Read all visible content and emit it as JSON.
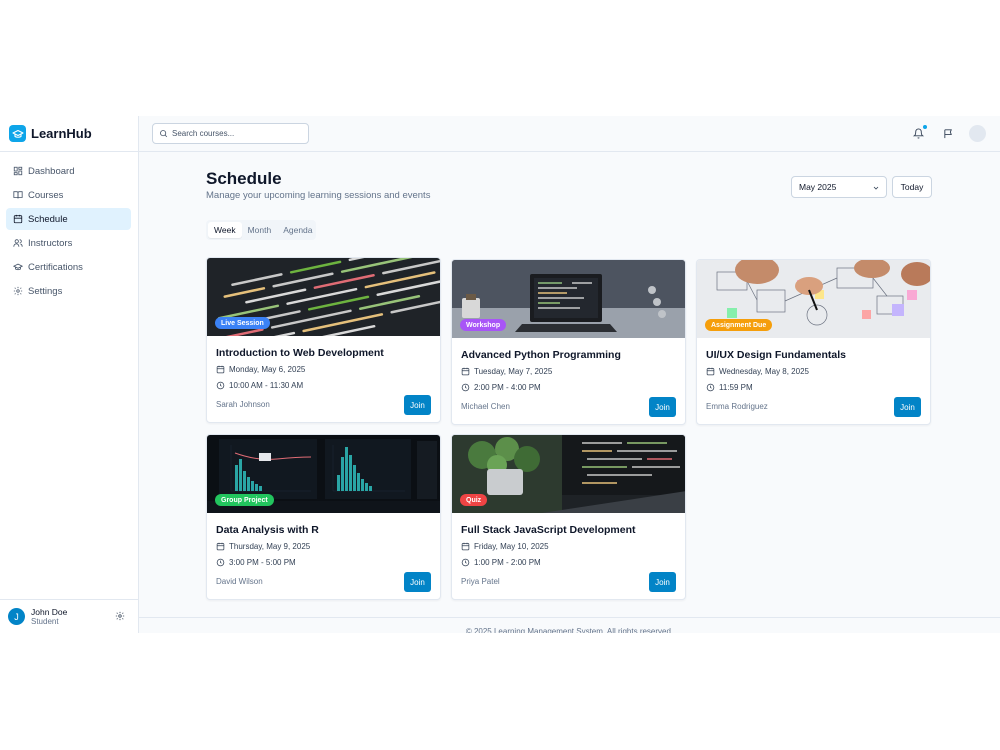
{
  "brand": {
    "name": "LearnHub",
    "color": "#0ea5e9"
  },
  "search": {
    "placeholder": "Search courses..."
  },
  "sidebar": {
    "items": [
      {
        "label": "Dashboard",
        "icon": "grid-icon"
      },
      {
        "label": "Courses",
        "icon": "book-icon"
      },
      {
        "label": "Schedule",
        "icon": "calendar-icon",
        "active": true
      },
      {
        "label": "Instructors",
        "icon": "users-icon"
      },
      {
        "label": "Certifications",
        "icon": "graduation-cap-icon"
      },
      {
        "label": "Settings",
        "icon": "gear-icon"
      }
    ]
  },
  "user": {
    "initial": "J",
    "name": "John Doe",
    "role": "Student"
  },
  "page": {
    "title": "Schedule",
    "subtitle": "Manage your upcoming learning sessions and events"
  },
  "controls": {
    "month": "May 2025",
    "today": "Today"
  },
  "tabs": [
    {
      "label": "Week",
      "active": true
    },
    {
      "label": "Month"
    },
    {
      "label": "Agenda"
    }
  ],
  "events": [
    {
      "badge": "Live Session",
      "badge_color": "#3b82f6",
      "title": "Introduction to Web Development",
      "date": "Monday, May 6, 2025",
      "time": "10:00 AM - 11:30 AM",
      "instructor": "Sarah Johnson",
      "join": "Join"
    },
    {
      "badge": "Workshop",
      "badge_color": "#a855f7",
      "title": "Advanced Python Programming",
      "date": "Tuesday, May 7, 2025",
      "time": "2:00 PM - 4:00 PM",
      "instructor": "Michael Chen",
      "join": "Join"
    },
    {
      "badge": "Assignment Due",
      "badge_color": "#f59e0b",
      "title": "UI/UX Design Fundamentals",
      "date": "Wednesday, May 8, 2025",
      "time": "11:59 PM",
      "instructor": "Emma Rodriguez",
      "join": "Join"
    },
    {
      "badge": "Group Project",
      "badge_color": "#22c55e",
      "title": "Data Analysis with R",
      "date": "Thursday, May 9, 2025",
      "time": "3:00 PM - 5:00 PM",
      "instructor": "David Wilson",
      "join": "Join"
    },
    {
      "badge": "Quiz",
      "badge_color": "#ef4444",
      "title": "Full Stack JavaScript Development",
      "date": "Friday, May 10, 2025",
      "time": "1:00 PM - 2:00 PM",
      "instructor": "Priya Patel",
      "join": "Join"
    }
  ],
  "footer": {
    "text": "© 2025 Learning Management System. All rights reserved."
  }
}
